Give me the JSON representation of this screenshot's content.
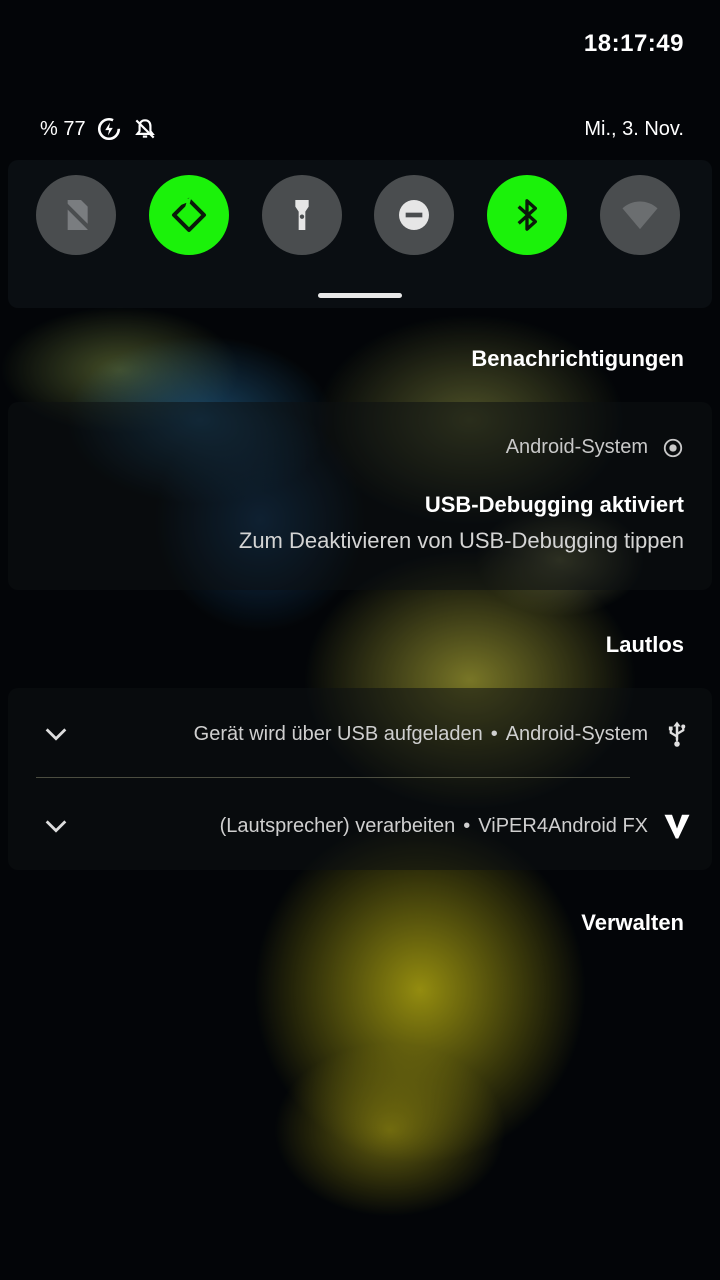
{
  "status_bar": {
    "clock": "18:17:49"
  },
  "qs_header": {
    "battery": "% 77",
    "battery_icon": "battery-saver-icon",
    "dnd_icon": "notifications-off-icon",
    "date": "Mi., 3. Nov."
  },
  "quick_tiles": [
    {
      "icon": "sim-off-icon",
      "active": false
    },
    {
      "icon": "auto-rotate-icon",
      "active": true
    },
    {
      "icon": "flashlight-icon",
      "active": false
    },
    {
      "icon": "do-not-disturb-icon",
      "active": false
    },
    {
      "icon": "bluetooth-icon",
      "active": true
    },
    {
      "icon": "wifi-icon",
      "active": false
    }
  ],
  "colors": {
    "tile_on": "#1bf20a",
    "tile_off": "#4a4d4f"
  },
  "notifications_header": "Benachrichtigungen",
  "usb_notification": {
    "app": "Android-System",
    "title": "USB-Debugging aktiviert",
    "text": "Zum Deaktivieren von USB-Debugging tippen"
  },
  "silent_header": "Lautlos",
  "silent_notifications": [
    {
      "text": "Gerät wird über USB aufgeladen",
      "separator": "•",
      "app": "Android-System",
      "icon": "usb-icon"
    },
    {
      "text": "(Lautsprecher) verarbeiten",
      "separator": "•",
      "app": "ViPER4Android FX",
      "icon": "viper-icon"
    }
  ],
  "manage_label": "Verwalten"
}
